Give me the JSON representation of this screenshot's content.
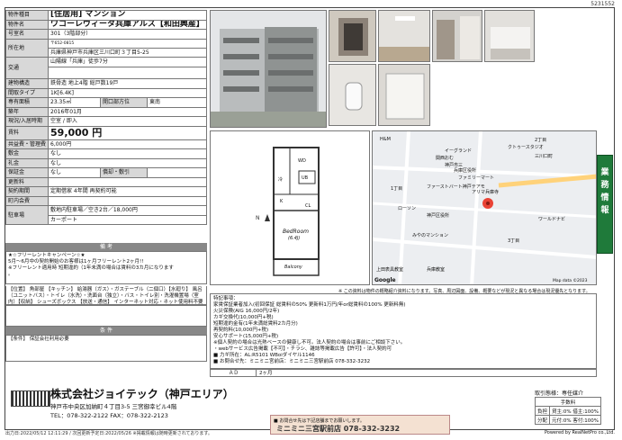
{
  "doc_id": "5231552",
  "spec": {
    "type_label": "物件種目",
    "type_value": "[住居用] マンション",
    "name_label": "物件名",
    "name_value": "ワコーレヴィータ兵庫アルス【和田興産】",
    "room_label": "号室名",
    "room_value": "301（3階部分）",
    "address_label": "所在地",
    "postal": "〒652-0815",
    "address_value": "兵庫県神戸市兵庫区三川口町３丁目5-25",
    "traffic_label": "交通",
    "traffic_value": "山陽線「兵庫」徒歩7分",
    "structure_label": "建物構造",
    "structure_value": "鉄骨造 地上4階 総戸数19戸",
    "layout_label": "間取タイプ",
    "layout_value": "1K[6.4K]",
    "area_label": "専有面積",
    "area_value": "23.35㎡",
    "direction_label": "開口部方位",
    "direction_value": "東南",
    "built_label": "築年",
    "built_value": "2016年01月",
    "status_label": "現況/入居時期",
    "status_value": "空室 / 即入",
    "rent_label": "賃料",
    "rent_value": "59,000 円",
    "fee_label": "共益費・管理費",
    "fee_value": "6,000円",
    "shikikin_label": "敷金",
    "shikikin_value": "なし",
    "reikin_label": "礼金",
    "reikin_value": "なし",
    "hoshokin_label": "保証金",
    "hoshokin_value": "なし",
    "shikibiki_label": "償却・敷引",
    "renewal_label": "更新料",
    "contract_label": "契約期間",
    "contract_value": "定期借家 4年間 再契約可能",
    "insurance_label": "町内会費",
    "parking_label": "駐車場",
    "parking_value": "敷地内駐車場／空き2台／18,000円",
    "parking_value2": "カーポート"
  },
  "remarks": {
    "header": "備 考",
    "line1": "★☆フリーレントキャンペーン☆★",
    "line2": "5月～6月中の契約開始のお客様は1ヶ月フリーレント2ヶ月!!",
    "line3": "※フリーレント適用時 短期違約（1年未満の場合は賃料の3カ月になります",
    "line4": "。"
  },
  "features": {
    "text": "【位置】 角部屋 【キッチン】 給湯器（ガス）・ガステーブル（二個口）【水廻り】 風呂（ユニットバス）・トイレ（水洗）・洗面台（独立）・バス・トイレ別・洗濯機置場（室内）【収納】 シューズボックス 【放送・通信】 インターネット対応・ネット使用料不要 【セキュリティ】 オートロック・防犯カメラ 【その他】 エレベーター（1基）・電気・ガス・水道・排水・バルコニー/ベランダ"
  },
  "conditions": {
    "header": "条 件",
    "text": "【条件】 保証会社利用必要"
  },
  "floor": {
    "room_name": "BedRoom",
    "room_size": "(6.4J)",
    "balcony": "Balcony",
    "closet": "CL",
    "ub": "UB",
    "wd": "WD",
    "ref": "冷",
    "k": "K"
  },
  "map": {
    "labels": [
      "H&M",
      "イーグランド",
      "関西おむ",
      "神戸市三",
      "兵庫区役所",
      "ファミリーマート",
      "ファーストバート神戸テアモ",
      "アリマ兵庫寺",
      "ローソン",
      "神戸区役所",
      "みやのマンション",
      "上田表具教室",
      "兵庫教室",
      "ワールドナビ",
      "Google",
      "Map data ©2023",
      "クトゥースタジオ",
      "三川口町",
      "2丁目",
      "3丁目",
      "1丁目"
    ]
  },
  "note": "※ この資料は物件の概略紹介資料になります。写真、周辺図面、設備、概要などが現況と異なる場合は現況優先となります。",
  "side_label": "業 務 情 報",
  "info": {
    "header": "特記事項：",
    "lines": [
      "家賃保証業者加入(初回保証 総賃料の50% 更新料1万円/年or総賃料の100% 更新料無)",
      "火災保険(AIG 16,000円/2年)",
      "カギ交換代(10,000円+税)",
      "短期違約金有(1年未満総賃料2カ月分)",
      "再契約料(10,000円+税)",
      "安心サポート(15,000円+税)",
      "※個人契約の場合は光熱ベースの健康し不可。法人契約の場合は事前にご相談下さい。",
      "・webサービス広告掲載【不可】・チラシ、雑誌等掲載広告【許可】・法人契約可",
      "■ 力ギ所在：AL:R5101 WBoiダイヤル1146",
      "■ お問合せ先：ミニミニ宮前店：ミニミニ三宮駅前店 078-332-3232"
    ]
  },
  "ad": {
    "label": "ＡＤ",
    "value": "2ヶ月"
  },
  "company": {
    "name": "株式会社ジョイテック（神戸エリア）",
    "address": "神戸市中央区加納町４丁目3-5 三宮御幸ビル4階",
    "tel": "TEL：078-322-2122 FAX：078-322-2123"
  },
  "agent": {
    "line1": "■ お問合せ先は下記店舗までお願いします。",
    "line2": "ミニミニ三宮駅前店 078-332-3232"
  },
  "fee": {
    "title": "取引態様：専任媒介",
    "header": "手数料",
    "row1_label": "負担",
    "row1_value": "貸主:0% 借主:100%",
    "row2_label": "分配",
    "row2_value": "元付:0% 客付:100%"
  },
  "footer": {
    "left": "出力日:2022/05/12 12:11:29 / 次回更新予定日:2022/05/26 ※掲載情報は随時更新されております。",
    "right": "Powered by RealNetPro co.,Ltd."
  }
}
